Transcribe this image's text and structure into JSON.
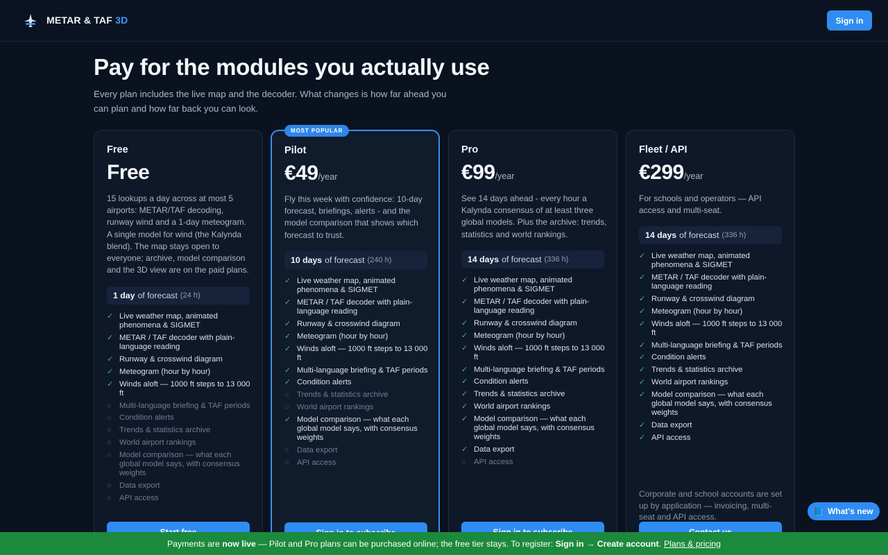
{
  "header": {
    "brand_main": "METAR & TAF",
    "brand_accent": "3D",
    "sign_in": "Sign in",
    "logo_icon": "plane-logo-icon"
  },
  "hero": {
    "title": "Pay for the modules you actually use",
    "subtitle": "Every plan includes the live map and the decoder. What changes is how far ahead you can plan and how far back you can look."
  },
  "plans": [
    {
      "name": "Free",
      "price": "Free",
      "per": "",
      "badge": "",
      "description": "15 lookups a day across at most 5 airports: METAR/TAF decoding, runway wind and a 1-day meteogram. A single model for wind (the Kalynda blend). The map stays open to everyone; archive, model comparison and the 3D view are on the paid plans.",
      "forecast_days": "1 day",
      "forecast_label": "of forecast",
      "forecast_hours": "(24 h)",
      "cta": "Start free",
      "note": "",
      "features": [
        {
          "label": "Live weather map, animated phenomena & SIGMET",
          "included": true
        },
        {
          "label": "METAR / TAF decoder with plain-language reading",
          "included": true
        },
        {
          "label": "Runway & crosswind diagram",
          "included": true
        },
        {
          "label": "Meteogram (hour by hour)",
          "included": true
        },
        {
          "label": "Winds aloft — 1000 ft steps to 13 000 ft",
          "included": true
        },
        {
          "label": "Multi-language briefing & TAF periods",
          "included": false
        },
        {
          "label": "Condition alerts",
          "included": false
        },
        {
          "label": "Trends & statistics archive",
          "included": false
        },
        {
          "label": "World airport rankings",
          "included": false
        },
        {
          "label": "Model comparison — what each global model says, with consensus weights",
          "included": false
        },
        {
          "label": "Data export",
          "included": false
        },
        {
          "label": "API access",
          "included": false
        }
      ]
    },
    {
      "name": "Pilot",
      "price": "€49",
      "per": "/year",
      "badge": "MOST POPULAR",
      "description": "Fly this week with confidence: 10-day forecast, briefings, alerts - and the model comparison that shows which forecast to trust.",
      "forecast_days": "10 days",
      "forecast_label": "of forecast",
      "forecast_hours": "(240 h)",
      "cta": "Sign in to subscribe",
      "note": "",
      "features": [
        {
          "label": "Live weather map, animated phenomena & SIGMET",
          "included": true
        },
        {
          "label": "METAR / TAF decoder with plain-language reading",
          "included": true
        },
        {
          "label": "Runway & crosswind diagram",
          "included": true
        },
        {
          "label": "Meteogram (hour by hour)",
          "included": true
        },
        {
          "label": "Winds aloft — 1000 ft steps to 13 000 ft",
          "included": true
        },
        {
          "label": "Multi-language briefing & TAF periods",
          "included": true
        },
        {
          "label": "Condition alerts",
          "included": true
        },
        {
          "label": "Trends & statistics archive",
          "included": false
        },
        {
          "label": "World airport rankings",
          "included": false
        },
        {
          "label": "Model comparison — what each global model says, with consensus weights",
          "included": true
        },
        {
          "label": "Data export",
          "included": false
        },
        {
          "label": "API access",
          "included": false
        }
      ]
    },
    {
      "name": "Pro",
      "price": "€99",
      "per": "/year",
      "badge": "",
      "description": "See 14 days ahead - every hour a Kalynda consensus of at least three global models. Plus the archive: trends, statistics and world rankings.",
      "forecast_days": "14 days",
      "forecast_label": "of forecast",
      "forecast_hours": "(336 h)",
      "cta": "Sign in to subscribe",
      "note": "",
      "features": [
        {
          "label": "Live weather map, animated phenomena & SIGMET",
          "included": true
        },
        {
          "label": "METAR / TAF decoder with plain-language reading",
          "included": true
        },
        {
          "label": "Runway & crosswind diagram",
          "included": true
        },
        {
          "label": "Meteogram (hour by hour)",
          "included": true
        },
        {
          "label": "Winds aloft — 1000 ft steps to 13 000 ft",
          "included": true
        },
        {
          "label": "Multi-language briefing & TAF periods",
          "included": true
        },
        {
          "label": "Condition alerts",
          "included": true
        },
        {
          "label": "Trends & statistics archive",
          "included": true
        },
        {
          "label": "World airport rankings",
          "included": true
        },
        {
          "label": "Model comparison — what each global model says, with consensus weights",
          "included": true
        },
        {
          "label": "Data export",
          "included": true
        },
        {
          "label": "API access",
          "included": false
        }
      ]
    },
    {
      "name": "Fleet / API",
      "price": "€299",
      "per": "/year",
      "badge": "",
      "description": "For schools and operators — API access and multi-seat.",
      "forecast_days": "14 days",
      "forecast_label": "of forecast",
      "forecast_hours": "(336 h)",
      "cta": "Contact us",
      "note": "Corporate and school accounts are set up by application — invoicing, multi-seat and API access.",
      "features": [
        {
          "label": "Live weather map, animated phenomena & SIGMET",
          "included": true
        },
        {
          "label": "METAR / TAF decoder with plain-language reading",
          "included": true
        },
        {
          "label": "Runway & crosswind diagram",
          "included": true
        },
        {
          "label": "Meteogram (hour by hour)",
          "included": true
        },
        {
          "label": "Winds aloft — 1000 ft steps to 13 000 ft",
          "included": true
        },
        {
          "label": "Multi-language briefing & TAF periods",
          "included": true
        },
        {
          "label": "Condition alerts",
          "included": true
        },
        {
          "label": "Trends & statistics archive",
          "included": true
        },
        {
          "label": "World airport rankings",
          "included": true
        },
        {
          "label": "Model comparison — what each global model says, with consensus weights",
          "included": true
        },
        {
          "label": "Data export",
          "included": true
        },
        {
          "label": "API access",
          "included": true
        }
      ]
    }
  ],
  "whats_new": {
    "label": "What's new",
    "icon": "book-icon"
  },
  "banner": {
    "t1": "Payments are",
    "t2": "now live",
    "t3": "— Pilot and Pro plans can be purchased online; the free tier stays. To register:",
    "t4": "Sign in → Create account",
    "t5": ".",
    "link": "Plans & pricing"
  },
  "colors": {
    "accent": "#2f8cf2",
    "included_check": "#3fb96a",
    "banner_bg": "#1c8a3c"
  }
}
